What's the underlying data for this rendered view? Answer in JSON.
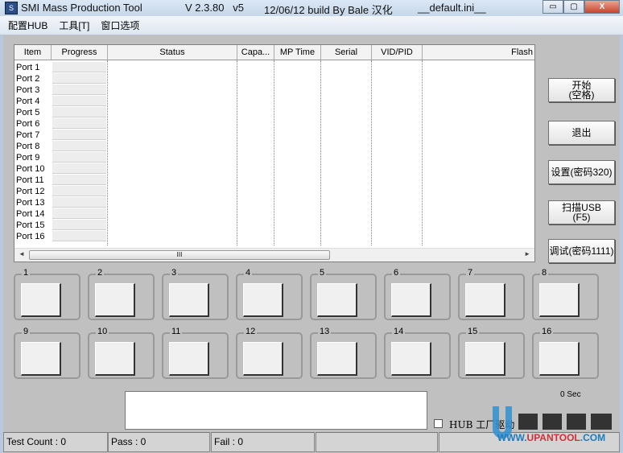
{
  "window": {
    "title": "SMI Mass Production Tool",
    "version": "V 2.3.80   v5",
    "build": "12/06/12 build By Bale 汉化",
    "ini": "__default.ini__",
    "controls": {
      "minimize": "▭",
      "maximize": "▢",
      "close": "X"
    }
  },
  "menu": [
    "配置HUB",
    "工具[T]",
    "窗口选项"
  ],
  "table": {
    "columns": [
      "Item",
      "Progress",
      "Status",
      "Capa...",
      "MP Time",
      "Serial",
      "VID/PID",
      "Flash"
    ],
    "rows": [
      "Port 1",
      "Port 2",
      "Port 3",
      "Port 4",
      "Port 5",
      "Port 6",
      "Port 7",
      "Port 8",
      "Port 9",
      "Port 10",
      "Port 11",
      "Port 12",
      "Port 13",
      "Port 14",
      "Port 15",
      "Port 16"
    ],
    "scroll_thumb": "III",
    "scroll_left": "◄",
    "scroll_right": "►"
  },
  "buttons": {
    "start": "开始\n(空格)",
    "exit": "退出",
    "settings": "设置(密码320)",
    "scan": "扫描USB\n(F5)",
    "debug": "调试(密码1111)"
  },
  "ports": [
    "1",
    "2",
    "3",
    "4",
    "5",
    "6",
    "7",
    "8",
    "9",
    "10",
    "11",
    "12",
    "13",
    "14",
    "15",
    "16"
  ],
  "timer": "0 Sec",
  "hub_checkbox": {
    "label": "HUB 工厂驱动",
    "checked": false
  },
  "statusbar": {
    "test_count": "Test Count : 0",
    "pass": "Pass : 0",
    "fail": "Fail : 0"
  },
  "watermark": {
    "brand": "U盘量产网",
    "url": "WWW.UPANTOOL.COM"
  }
}
